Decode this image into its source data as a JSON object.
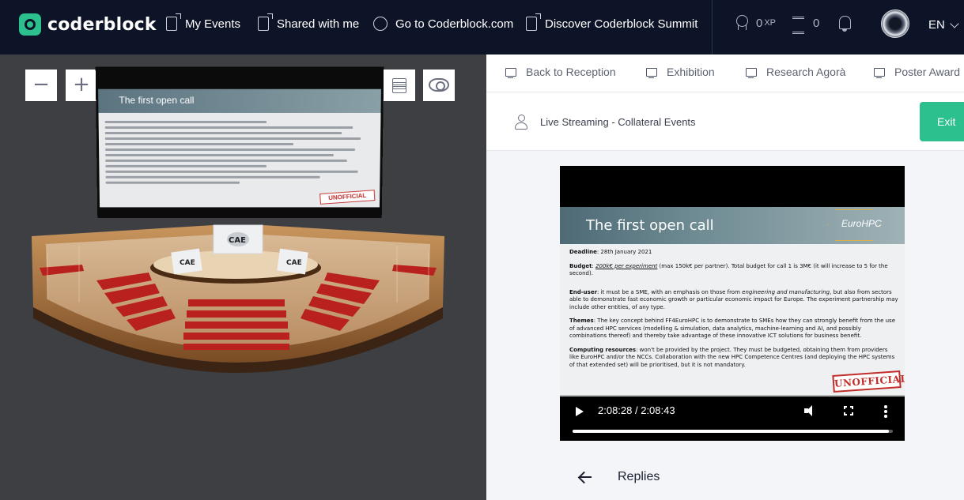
{
  "app": {
    "name": "coderblock"
  },
  "nav": {
    "items": [
      {
        "label": "My Events",
        "icon": "document-icon"
      },
      {
        "label": "Shared with me",
        "icon": "document-icon"
      },
      {
        "label": "Go to Coderblock.com",
        "icon": "circle-icon"
      },
      {
        "label": "Discover Coderblock Summit",
        "icon": "document-icon"
      }
    ],
    "xp_value": "0",
    "xp_unit": "XP",
    "coins_value": "0",
    "language": "EN"
  },
  "scene": {
    "zoom_out_label": "−",
    "zoom_in_label": "+",
    "screen_title": "The first open call",
    "screen_stamp": "UNOFFICIAL"
  },
  "tabs": [
    {
      "label": "Back to Reception"
    },
    {
      "label": "Exhibition"
    },
    {
      "label": "Research Agorà"
    },
    {
      "label": "Poster Award"
    }
  ],
  "room": {
    "title": "Live Streaming - Collateral Events",
    "exit_label": "Exit"
  },
  "slide": {
    "title": "The first open call",
    "logo_text": "EuroHPC",
    "deadline_label": "Deadline",
    "deadline_value": ": 28th January 2021",
    "budget_label": "Budget",
    "budget_emph": "200k€ per experiment",
    "budget_rest": " (max 150k€ per partner). Total budget for call 1 is 3M€ (it will increase to 5 for the second).",
    "enduser_label": "End-user",
    "enduser_a": ": it must be a SME, with an emphasis on those from ",
    "enduser_emph": "engineering and manufacturing",
    "enduser_b": ", but also from sectors able to demonstrate fast economic growth or particular economic impact for Europe. The experiment partnership may include other entities, of any type.",
    "themes_label": "Themes",
    "themes_text": ": The key concept behind FF4EuroHPC is to demonstrate to SMEs how they can strongly benefit from the use of advanced HPC services (modelling & simulation, data analytics, machine-learning and AI, and possibly combinations thereof) and thereby take advantage of these innovative ICT solutions for business benefit.",
    "computing_label": "Computing resources",
    "computing_text": ": won't be provided by the project. They must be budgeted, obtaining them from providers like EuroHPC and/or the NCCs. Collaboration with the new HPC Competence Centres (and deploying the HPC systems of that extended set) will be prioritised, but it is not mandatory.",
    "stamp": "UNOFFICIAL"
  },
  "video": {
    "time": "2:08:28 / 2:08:43",
    "progress": 0.988
  },
  "replies": {
    "label": "Replies"
  },
  "colors": {
    "accent": "#2cc08f",
    "topbar": "#0e1427"
  }
}
